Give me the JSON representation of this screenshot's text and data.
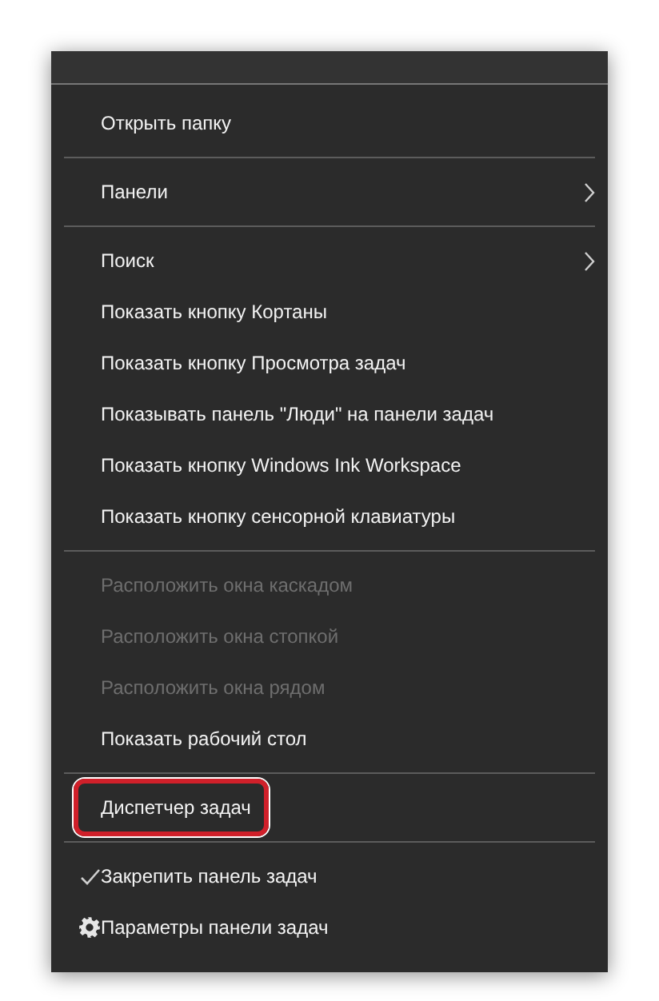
{
  "menu": {
    "sections": [
      {
        "items": [
          {
            "label": "Открыть папку",
            "kind": "plain",
            "disabled": false,
            "submenu": false,
            "highlighted": false
          }
        ]
      },
      {
        "items": [
          {
            "label": "Панели",
            "kind": "plain",
            "disabled": false,
            "submenu": true,
            "highlighted": false
          }
        ]
      },
      {
        "items": [
          {
            "label": "Поиск",
            "kind": "plain",
            "disabled": false,
            "submenu": true,
            "highlighted": false
          },
          {
            "label": "Показать кнопку Кортаны",
            "kind": "plain",
            "disabled": false,
            "submenu": false,
            "highlighted": false
          },
          {
            "label": "Показать кнопку Просмотра задач",
            "kind": "plain",
            "disabled": false,
            "submenu": false,
            "highlighted": false
          },
          {
            "label": "Показывать панель \"Люди\" на панели задач",
            "kind": "plain",
            "disabled": false,
            "submenu": false,
            "highlighted": false
          },
          {
            "label": "Показать кнопку Windows Ink Workspace",
            "kind": "plain",
            "disabled": false,
            "submenu": false,
            "highlighted": false
          },
          {
            "label": "Показать кнопку сенсорной клавиатуры",
            "kind": "plain",
            "disabled": false,
            "submenu": false,
            "highlighted": false
          }
        ]
      },
      {
        "items": [
          {
            "label": "Расположить окна каскадом",
            "kind": "plain",
            "disabled": true,
            "submenu": false,
            "highlighted": false
          },
          {
            "label": "Расположить окна стопкой",
            "kind": "plain",
            "disabled": true,
            "submenu": false,
            "highlighted": false
          },
          {
            "label": "Расположить окна рядом",
            "kind": "plain",
            "disabled": true,
            "submenu": false,
            "highlighted": false
          },
          {
            "label": "Показать рабочий стол",
            "kind": "plain",
            "disabled": false,
            "submenu": false,
            "highlighted": false
          }
        ]
      },
      {
        "items": [
          {
            "label": "Диспетчер задач",
            "kind": "plain",
            "disabled": false,
            "submenu": false,
            "highlighted": true
          }
        ]
      },
      {
        "items": [
          {
            "label": "Закрепить панель задач",
            "kind": "check",
            "checked": true,
            "disabled": false,
            "submenu": false,
            "highlighted": false
          },
          {
            "label": "Параметры панели задач",
            "kind": "gear",
            "disabled": false,
            "submenu": false,
            "highlighted": false
          }
        ]
      }
    ]
  }
}
